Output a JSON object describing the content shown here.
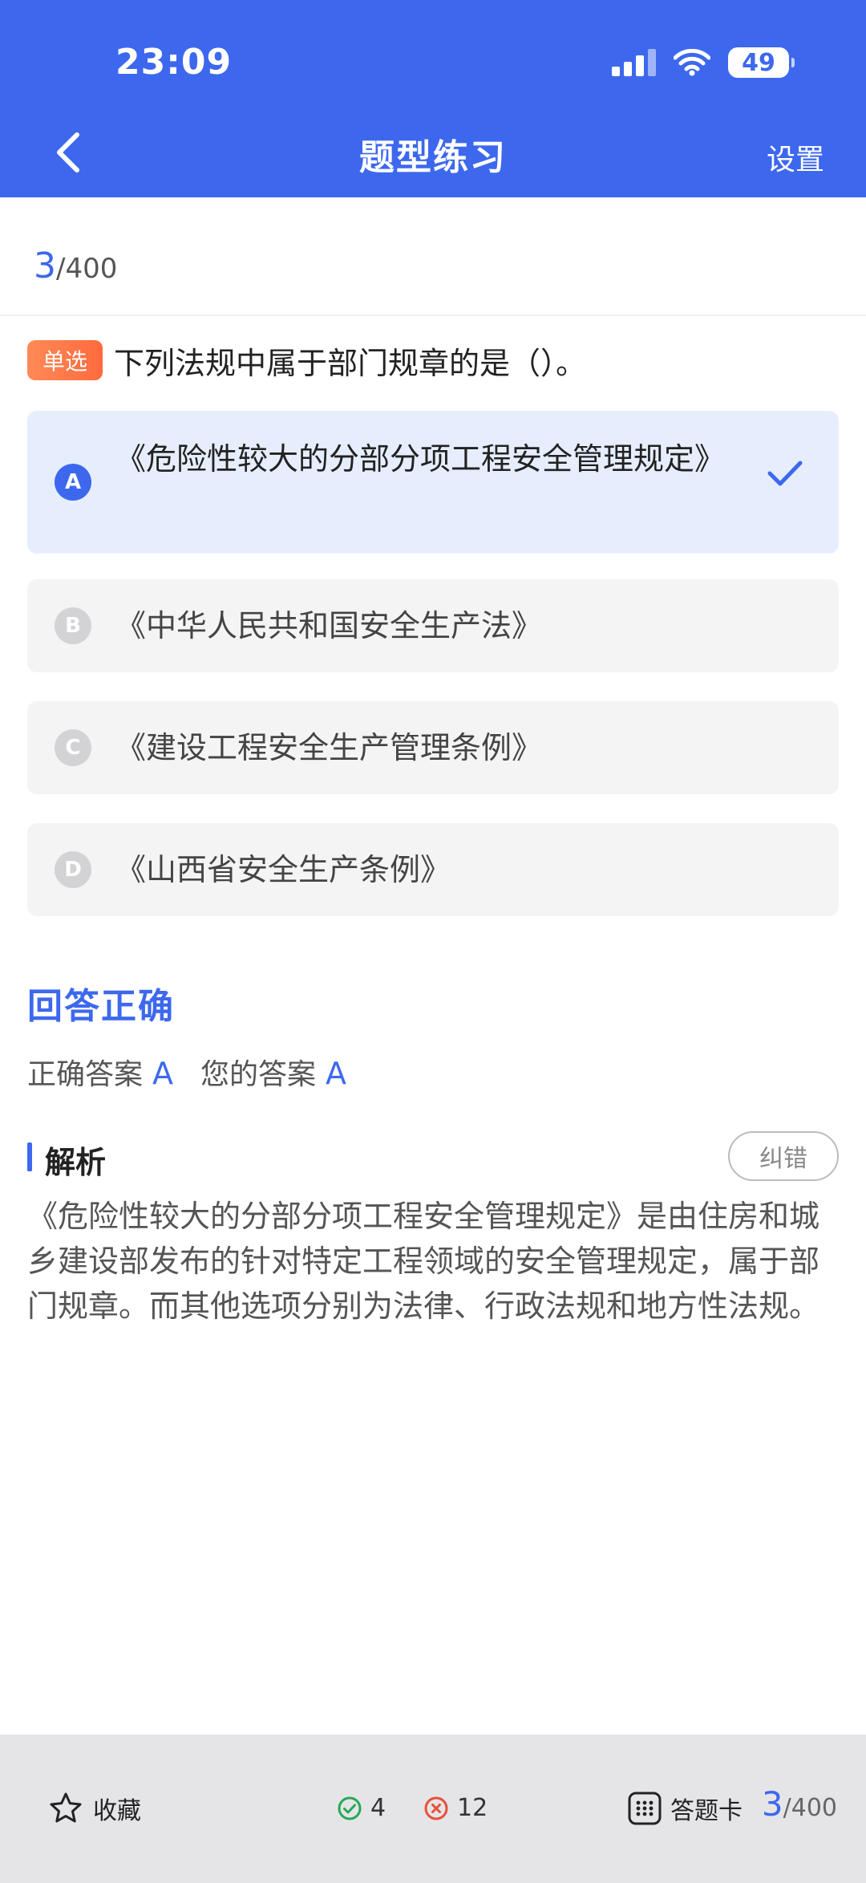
{
  "status_bar": {
    "time": "23:09",
    "battery": "49"
  },
  "nav": {
    "title": "题型练习",
    "settings": "设置"
  },
  "progress": {
    "current": "3",
    "total": "/400"
  },
  "question": {
    "type": "单选",
    "text": "下列法规中属于部门规章的是（）。"
  },
  "options": [
    {
      "letter": "A",
      "text": "《危险性较大的分部分项工程安全管理规定》",
      "selected": true
    },
    {
      "letter": "B",
      "text": "《中华人民共和国安全生产法》",
      "selected": false
    },
    {
      "letter": "C",
      "text": "《建设工程安全生产管理条例》",
      "selected": false
    },
    {
      "letter": "D",
      "text": "《山西省安全生产条例》",
      "selected": false
    }
  ],
  "result": {
    "title": "回答正确",
    "correct_label": "正确答案",
    "correct_value": "A",
    "yours_label": "您的答案",
    "yours_value": "A"
  },
  "analysis": {
    "title": "解析",
    "report": "纠错",
    "text": "《危险性较大的分部分项工程安全管理规定》是由住房和城乡建设部发布的针对特定工程领域的安全管理规定，属于部门规章。而其他选项分别为法律、行政法规和地方性法规。"
  },
  "bottom_bar": {
    "favorite": "收藏",
    "correct_count": "4",
    "wrong_count": "12",
    "answer_card": "答题卡",
    "current": "3",
    "total": "/400"
  },
  "colors": {
    "primary": "#3d68ee",
    "tag": "#ff6a3d",
    "correct": "#27a85a",
    "wrong": "#e8503a"
  }
}
